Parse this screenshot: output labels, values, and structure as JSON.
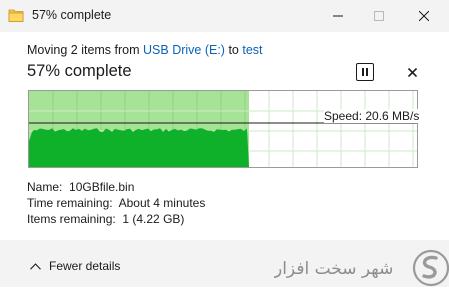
{
  "window": {
    "title": "57% complete",
    "icons": {
      "app": "file-copy-icon",
      "minimize": "minimize-icon",
      "maximize": "maximize-icon",
      "close": "close-icon"
    }
  },
  "header": {
    "prefix": "Moving 2 items from ",
    "source": "USB Drive (E:)",
    "middle": " to ",
    "destination": "test",
    "link_color": "#0b63b9"
  },
  "status": {
    "title": "57% complete",
    "percent": 57,
    "pause_icon": "pause-icon",
    "stop_icon": "stop-icon"
  },
  "graph": {
    "speed_label": "Speed: 20.6 MB/s",
    "progress_fraction": 0.57,
    "fill_color": "#a6e396",
    "speed_color": "#0fb12a"
  },
  "details": {
    "name_label": "Name:",
    "name_value": "10GBfile.bin",
    "time_label": "Time remaining:",
    "time_value": "About 4 minutes",
    "items_label": "Items remaining:",
    "items_value": "1 (4.22 GB)"
  },
  "footer": {
    "fewer_details": "Fewer details",
    "chevron_icon": "chevron-up-icon"
  },
  "watermark": {
    "text": "شهر سخت افزار",
    "logo_icon": "logo-icon"
  }
}
